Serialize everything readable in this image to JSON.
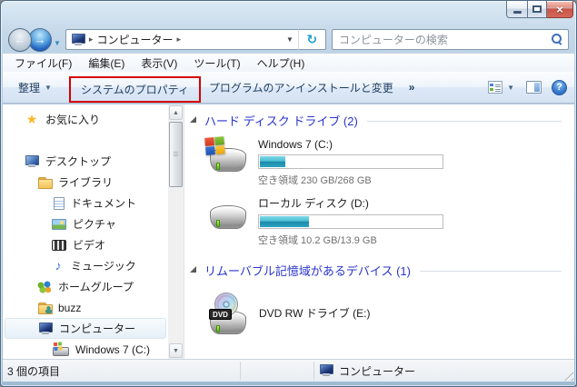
{
  "window_controls": {
    "close_glyph": "×"
  },
  "icons": {
    "caret_down": "▼",
    "small_caret": "▼",
    "breadcrumb_arrow": "▸",
    "refresh": "↻",
    "help": "?",
    "scroll_up": "▲",
    "scroll_down": "▼",
    "back_arrow": "←",
    "forward_arrow": "→"
  },
  "address": {
    "crumb": "コンピューター"
  },
  "search": {
    "placeholder": "コンピューターの検索"
  },
  "menubar": {
    "items": [
      "ファイル(F)",
      "編集(E)",
      "表示(V)",
      "ツール(T)",
      "ヘルプ(H)"
    ]
  },
  "toolbar": {
    "organize_label": "整理",
    "system_properties_label": "システムのプロパティ",
    "uninstall_label": "プログラムのアンインストールと変更",
    "overflow_label": "»"
  },
  "sidebar": {
    "items": [
      {
        "label": "お気に入り"
      },
      {
        "label": "デスクトップ"
      },
      {
        "label": "ライブラリ"
      },
      {
        "label": "ドキュメント"
      },
      {
        "label": "ピクチャ"
      },
      {
        "label": "ビデオ"
      },
      {
        "label": "ミュージック"
      },
      {
        "label": "ホームグループ"
      },
      {
        "label": "buzz"
      },
      {
        "label": "コンピューター",
        "selected": true
      },
      {
        "label": "Windows 7 (C:)"
      }
    ]
  },
  "main": {
    "groups": [
      {
        "title": "ハード ディスク ドライブ (2)",
        "items": [
          {
            "name": "Windows 7 (C:)",
            "free_text": "空き領域 230 GB/268 GB",
            "free_gb": 230,
            "total_gb": 268,
            "used_percent": 14
          },
          {
            "name": "ローカル ディスク (D:)",
            "free_text": "空き領域 10.2 GB/13.9 GB",
            "free_gb": 10.2,
            "total_gb": 13.9,
            "used_percent": 27
          }
        ]
      },
      {
        "title": "リムーバブル記憶域があるデバイス (1)",
        "items": [
          {
            "name": "DVD RW ドライブ (E:)",
            "badge": "DVD"
          }
        ]
      }
    ]
  },
  "statusbar": {
    "items_count": "3 個の項目",
    "location": "コンピューター"
  },
  "colors": {
    "annotation_red": "#D50000",
    "capacity_bar_teal": "#2AA3C0",
    "group_header_blue": "#2A35CC"
  }
}
